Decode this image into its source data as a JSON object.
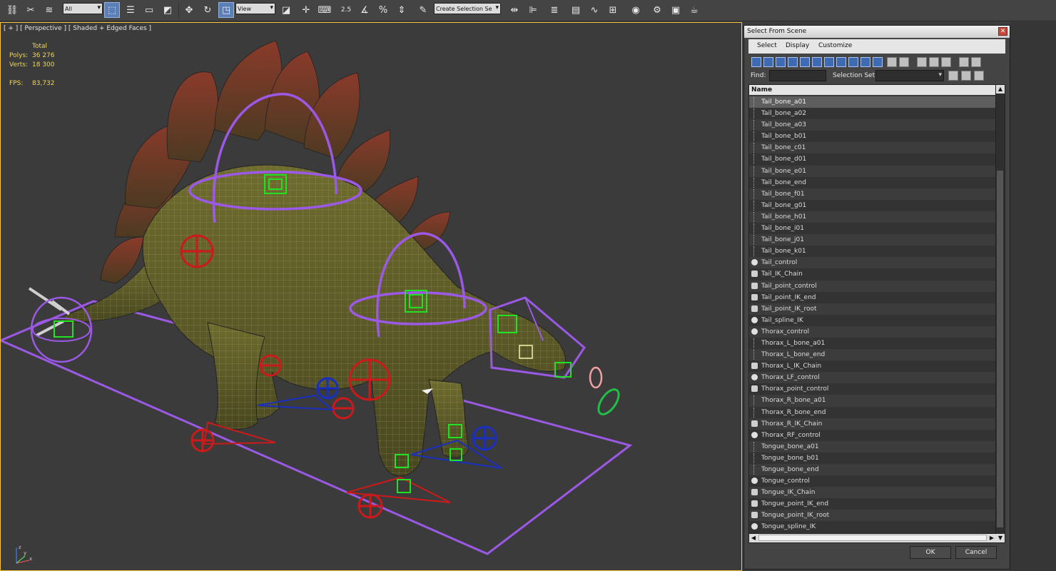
{
  "toolbar": {
    "filter_select": "All",
    "ref_coord_select": "View",
    "snap_angle_label": "2.5",
    "percent_label": "%",
    "named_selection_placeholder": "Create Selection Se"
  },
  "viewport": {
    "label": "[ + ] [ Perspective ] [ Shaded + Edged Faces ]",
    "stats": {
      "header": "Total",
      "polys_label": "Polys:",
      "polys_value": "36 276",
      "verts_label": "Verts:",
      "verts_value": "18 300",
      "fps_label": "FPS:",
      "fps_value": "83,732"
    },
    "axis": {
      "x": "x",
      "y": "y",
      "z": "z"
    },
    "colors": {
      "border": "#f4c43a",
      "ik_solver": "#9b59e6",
      "controls_red": "#cc1a1a",
      "controls_blue": "#1a2fbf",
      "helpers_green": "#22e022"
    }
  },
  "dialog": {
    "title": "Select From Scene",
    "menu": [
      "Select",
      "Display",
      "Customize"
    ],
    "find_label": "Find:",
    "find_value": "",
    "selection_set_label": "Selection Set:",
    "column_header": "Name",
    "items": [
      {
        "name": "Tail_bone_a01",
        "icon": "bone",
        "selected": true
      },
      {
        "name": "Tail_bone_a02",
        "icon": "bone"
      },
      {
        "name": "Tail_bone_a03",
        "icon": "bone"
      },
      {
        "name": "Tail_bone_b01",
        "icon": "bone"
      },
      {
        "name": "Tail_bone_c01",
        "icon": "bone"
      },
      {
        "name": "Tail_bone_d01",
        "icon": "bone"
      },
      {
        "name": "Tail_bone_e01",
        "icon": "bone"
      },
      {
        "name": "Tail_bone_end",
        "icon": "bone"
      },
      {
        "name": "Tail_bone_f01",
        "icon": "bone"
      },
      {
        "name": "Tail_bone_g01",
        "icon": "bone"
      },
      {
        "name": "Tail_bone_h01",
        "icon": "bone"
      },
      {
        "name": "Tail_bone_i01",
        "icon": "bone"
      },
      {
        "name": "Tail_bone_j01",
        "icon": "bone"
      },
      {
        "name": "Tail_bone_k01",
        "icon": "bone"
      },
      {
        "name": "Tail_control",
        "icon": "spline"
      },
      {
        "name": "Tail_IK_Chain",
        "icon": "helper"
      },
      {
        "name": "Tail_point_control",
        "icon": "helper"
      },
      {
        "name": "Tail_point_IK_end",
        "icon": "helper"
      },
      {
        "name": "Tail_point_IK_root",
        "icon": "helper"
      },
      {
        "name": "Tail_spline_IK",
        "icon": "spline"
      },
      {
        "name": "Thorax_control",
        "icon": "spline"
      },
      {
        "name": "Thorax_L_bone_a01",
        "icon": "bone"
      },
      {
        "name": "Thorax_L_bone_end",
        "icon": "bone"
      },
      {
        "name": "Thorax_L_IK_Chain",
        "icon": "helper"
      },
      {
        "name": "Thorax_LF_control",
        "icon": "spline"
      },
      {
        "name": "Thorax_point_control",
        "icon": "helper"
      },
      {
        "name": "Thorax_R_bone_a01",
        "icon": "bone"
      },
      {
        "name": "Thorax_R_bone_end",
        "icon": "bone"
      },
      {
        "name": "Thorax_R_IK_Chain",
        "icon": "helper"
      },
      {
        "name": "Thorax_RF_control",
        "icon": "spline"
      },
      {
        "name": "Tongue_bone_a01",
        "icon": "bone"
      },
      {
        "name": "Tongue_bone_b01",
        "icon": "bone"
      },
      {
        "name": "Tongue_bone_end",
        "icon": "bone"
      },
      {
        "name": "Tongue_control",
        "icon": "spline"
      },
      {
        "name": "Tongue_IK_Chain",
        "icon": "helper"
      },
      {
        "name": "Tongue_point_IK_end",
        "icon": "helper"
      },
      {
        "name": "Tongue_point_IK_root",
        "icon": "helper"
      },
      {
        "name": "Tongue_spline_IK",
        "icon": "spline"
      }
    ],
    "ok_label": "OK",
    "cancel_label": "Cancel"
  }
}
